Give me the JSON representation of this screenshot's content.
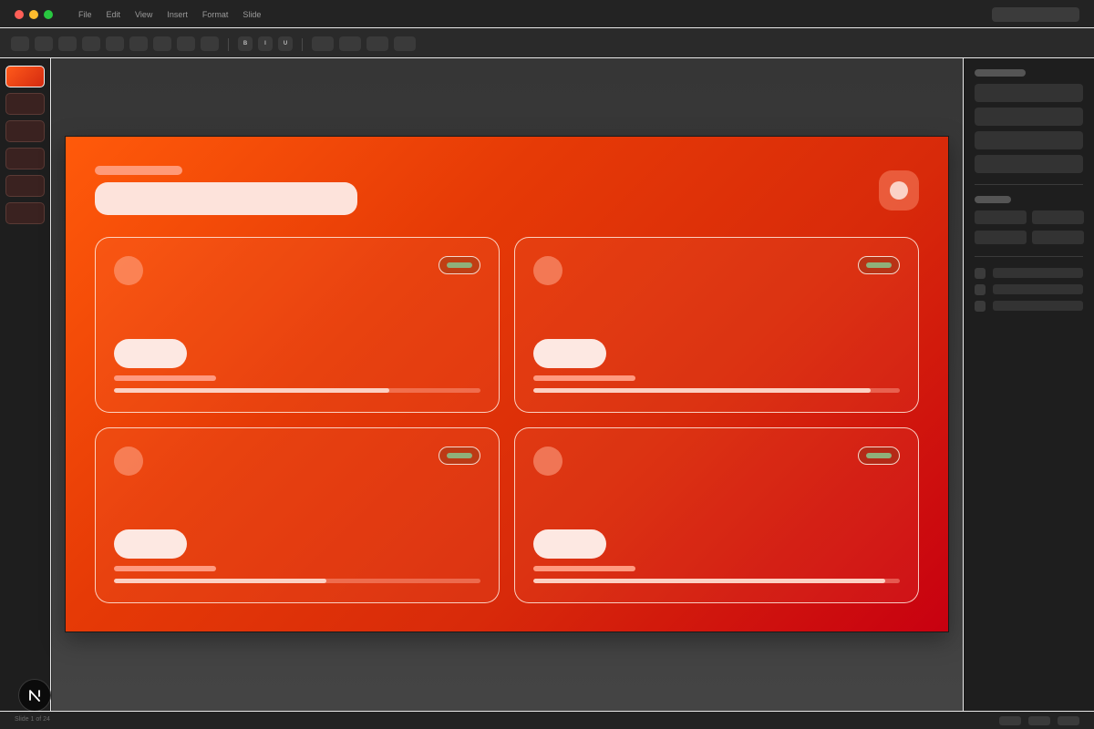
{
  "window": {
    "menu": [
      "File",
      "Edit",
      "View",
      "Insert",
      "Format",
      "Slide"
    ]
  },
  "toolbar": {
    "bold_label": "B",
    "italic_label": "I",
    "underline_label": "U"
  },
  "slides": {
    "count": 6,
    "active_index": 0
  },
  "slide": {
    "colors": {
      "gradient_start": "#ff5a0a",
      "gradient_end": "#c80010",
      "card_badge": "#8fb07a"
    },
    "cards": [
      {
        "progress": 0.75
      },
      {
        "progress": 0.92
      },
      {
        "progress": 0.58
      },
      {
        "progress": 0.96
      }
    ]
  },
  "status": {
    "slide_indicator": "Slide 1 of 24"
  }
}
